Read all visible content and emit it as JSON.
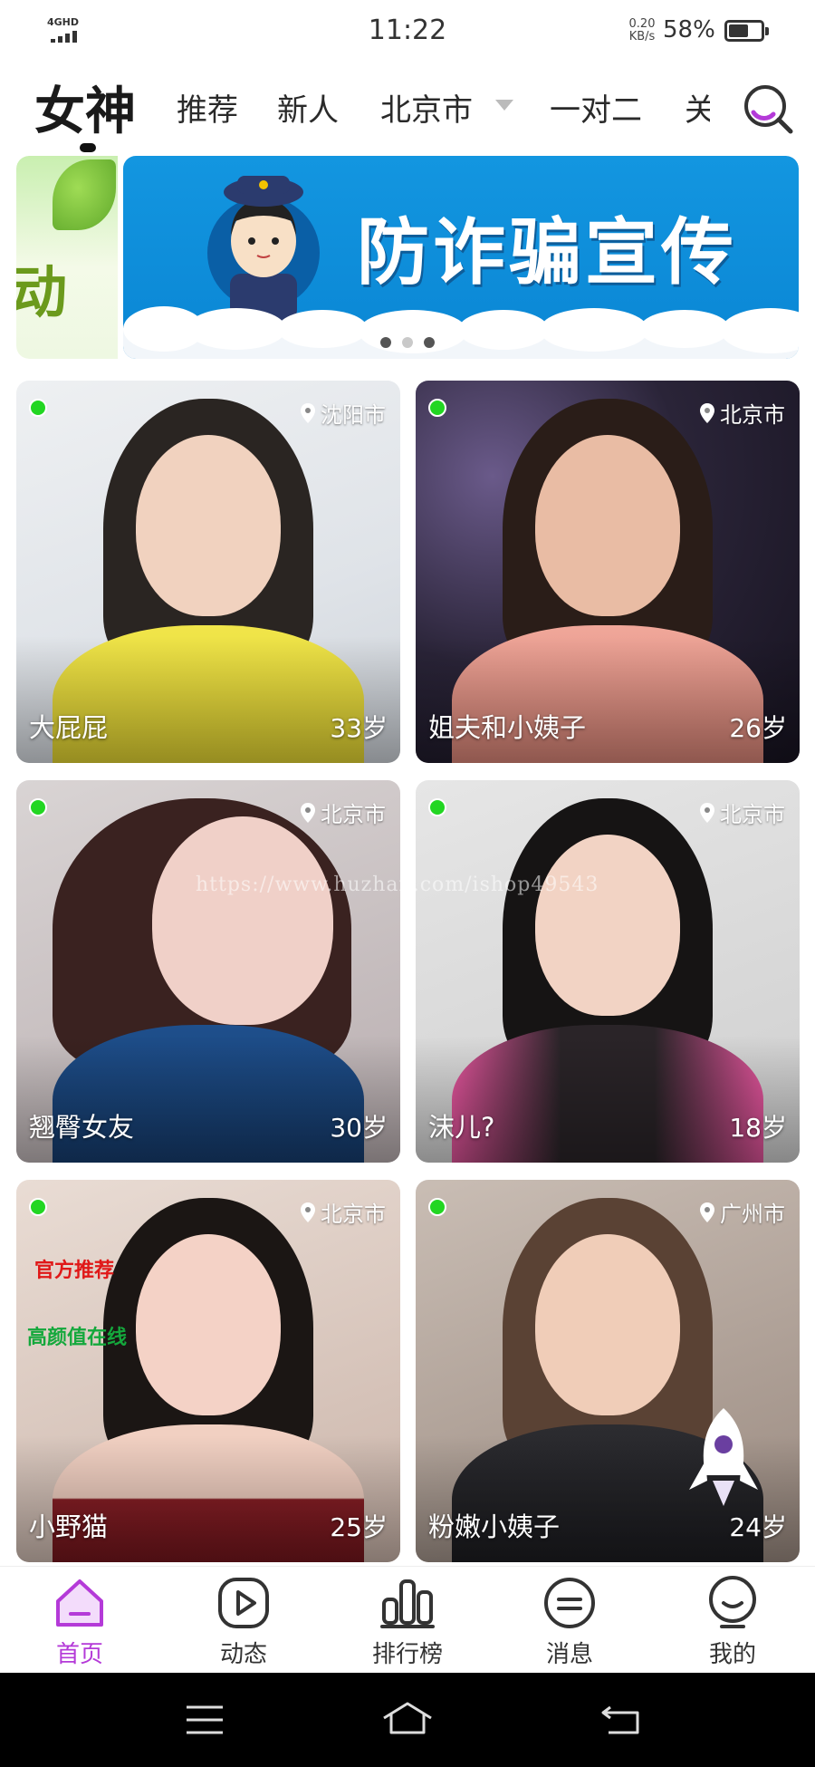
{
  "status_bar": {
    "network": "4GHD",
    "time": "11:22",
    "net_speed_value": "0.20",
    "net_speed_unit": "KB/s",
    "battery_percent": "58%"
  },
  "nav": {
    "title": "女神",
    "tabs": [
      "推荐",
      "新人",
      "北京市",
      "一对二",
      "关"
    ]
  },
  "banner": {
    "prev_text": "动",
    "text": "防诈骗宣传",
    "slide_count": 3,
    "active_slide": 2
  },
  "cards": [
    {
      "name": "大屁屁",
      "age": "33岁",
      "city": "沈阳市",
      "online": true
    },
    {
      "name": "姐夫和小姨子",
      "age": "26岁",
      "city": "北京市",
      "online": true
    },
    {
      "name": "翘臀女友",
      "age": "30岁",
      "city": "北京市",
      "online": true
    },
    {
      "name": "沫儿?",
      "age": "18岁",
      "city": "北京市",
      "online": true
    },
    {
      "name": "小野猫",
      "age": "25岁",
      "city": "北京市",
      "online": true,
      "tag_red": "官方推荐",
      "tag_green": "高颜值在线"
    },
    {
      "name": "粉嫩小姨子",
      "age": "24岁",
      "city": "广州市",
      "online": true
    }
  ],
  "watermark": "https://www.huzhan.com/ishop49543",
  "tabbar": {
    "items": [
      {
        "label": "首页",
        "icon": "home-icon",
        "active": true
      },
      {
        "label": "动态",
        "icon": "play-icon",
        "active": false
      },
      {
        "label": "排行榜",
        "icon": "ranking-icon",
        "active": false
      },
      {
        "label": "消息",
        "icon": "message-icon",
        "active": false
      },
      {
        "label": "我的",
        "icon": "profile-icon",
        "active": false
      }
    ]
  },
  "colors": {
    "accent": "#b43ad8",
    "online": "#22d622",
    "banner_blue": "#0a86d4"
  }
}
